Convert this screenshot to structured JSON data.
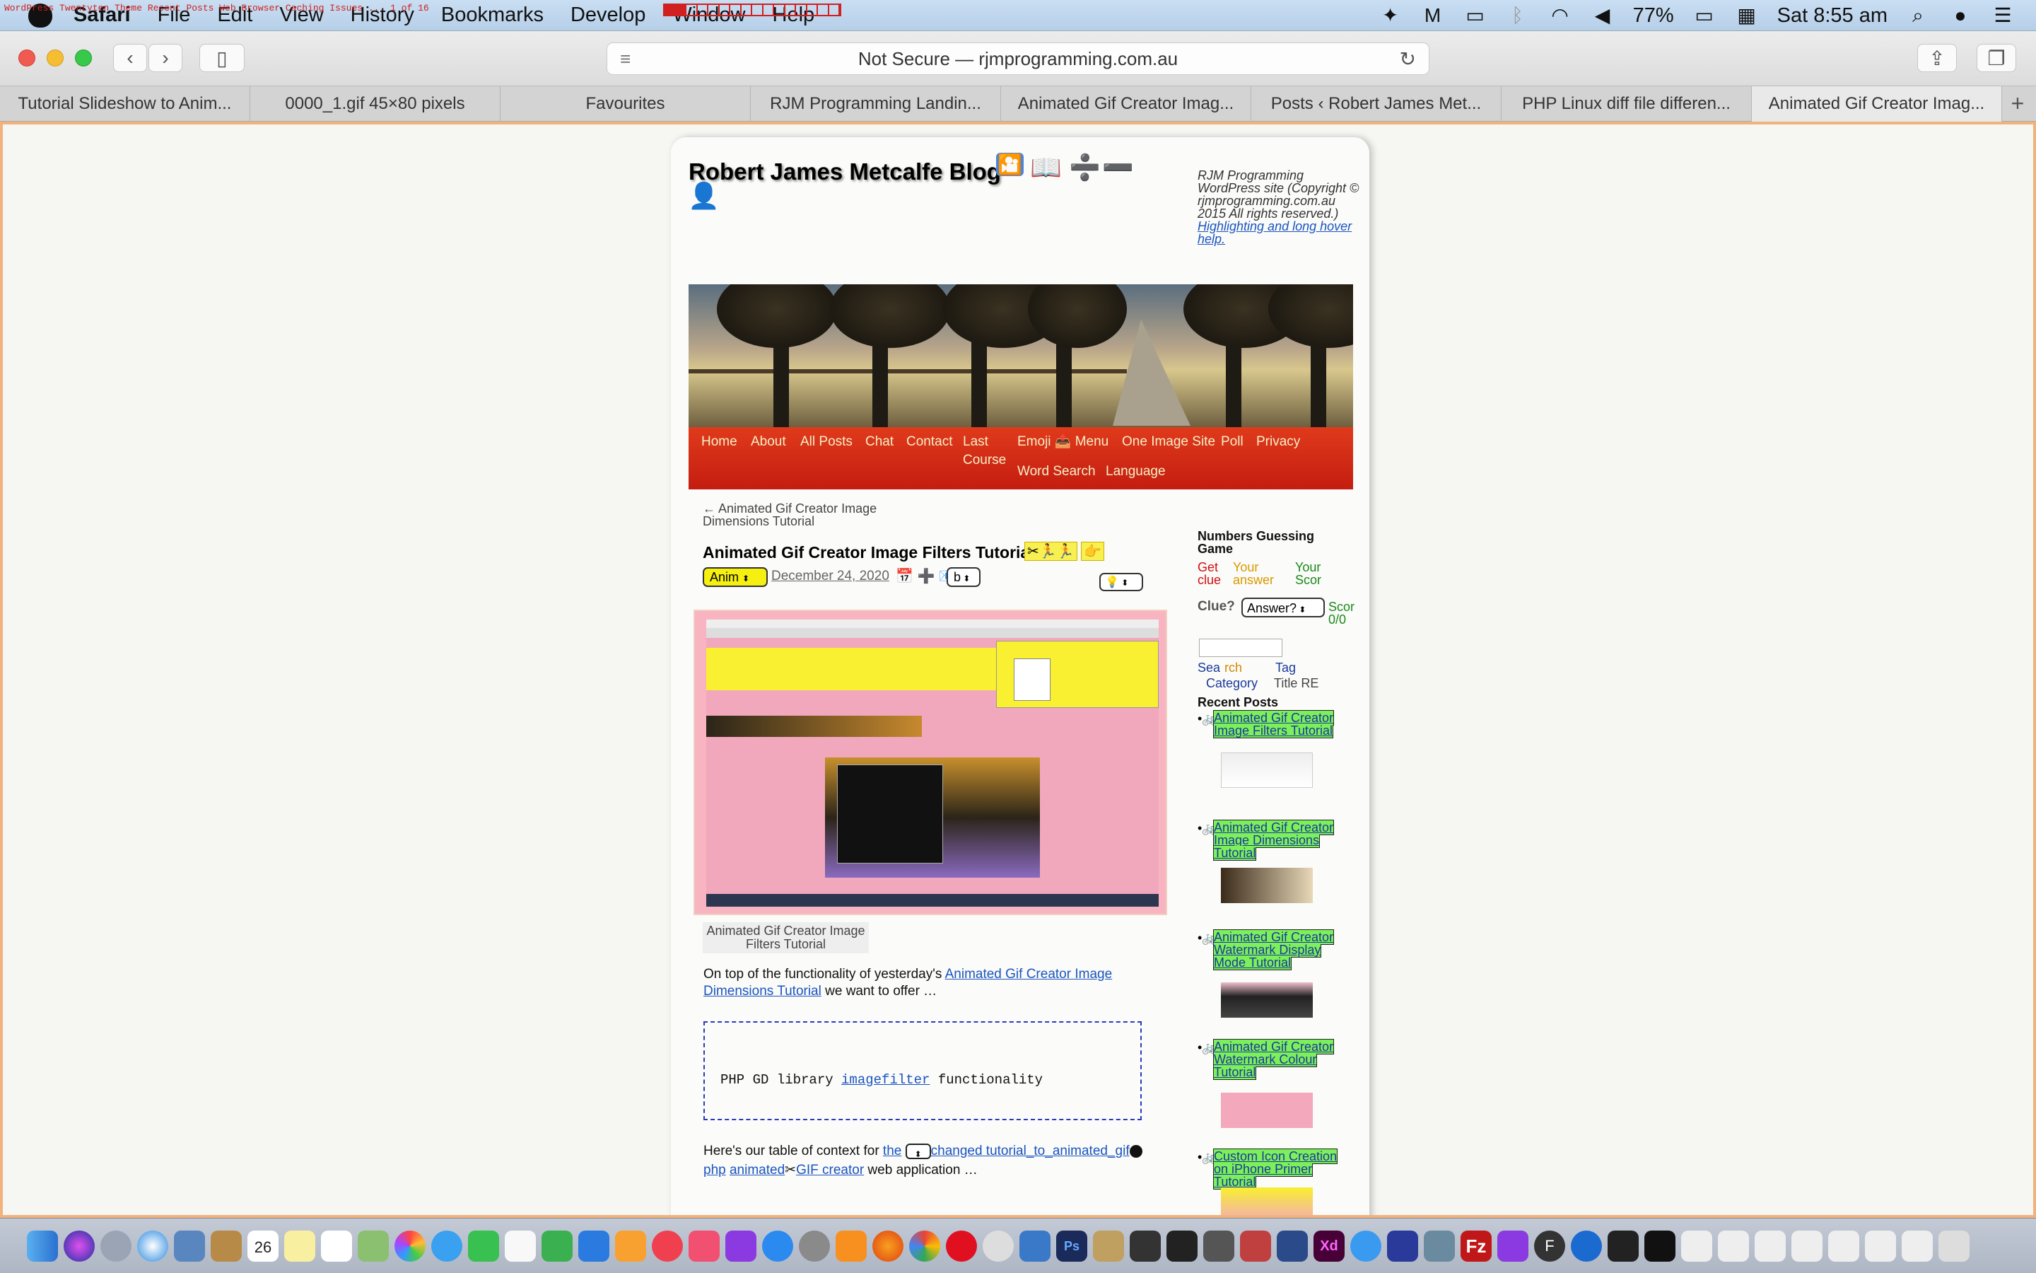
{
  "menubar": {
    "ticker": "WordPress Twentyten Theme Recent Posts Web Browser Caching Issues ... 1 of 16",
    "app": "Safari",
    "items": [
      "File",
      "Edit",
      "View",
      "History",
      "Bookmarks",
      "Develop",
      "Window",
      "Help"
    ],
    "battery": "77%",
    "clock": "Sat 8:55 am"
  },
  "toolbar": {
    "url": "Not Secure — rjmprogramming.com.au"
  },
  "tabs": [
    "Tutorial Slideshow to Anim...",
    "0000_1.gif 45×80 pixels",
    "Favourites",
    "RJM Programming Landin...",
    "Animated Gif Creator Imag...",
    "Posts ‹ Robert James Met...",
    "PHP Linux diff file differen...",
    "Animated Gif Creator Imag..."
  ],
  "blog": {
    "title": "Robert James Metcalfe Blog",
    "title_icons": [
      "🎦",
      "📖",
      "➗",
      "➖",
      "👤"
    ],
    "note_line1": "RJM Programming WordPress site (Copyright © rjmprogramming.com.au 2015 All rights reserved.)",
    "note_link": "Highlighting and long hover help."
  },
  "nav": [
    {
      "label": "Home"
    },
    {
      "label": "About"
    },
    {
      "label": "All Posts"
    },
    {
      "label": "Chat"
    },
    {
      "label": "Contact"
    },
    {
      "label": "Last Course"
    },
    {
      "label": "Emoji 📤 Menu"
    },
    {
      "label": "One Image Site"
    },
    {
      "label": "Poll"
    },
    {
      "label": "Privacy"
    },
    {
      "label": "Word Search"
    },
    {
      "label": "Language"
    }
  ],
  "post": {
    "prev_link": "← Animated Gif Creator Image Dimensions Tutorial",
    "title": "Animated Gif Creator Image Filters Tutorial",
    "title_emojis": "✂🏃🏃",
    "title_emoji2": "👉",
    "category_select": "Anim",
    "date": "December 24, 2020",
    "date_icons": "📅 ➕ 📧",
    "b_select": "b",
    "bulb_select": "💡",
    "caption": "Animated Gif Creator Image Filters Tutorial",
    "intro_prefix": "On top of the functionality of yesterday's ",
    "intro_link": "Animated Gif Creator Image Dimensions Tutorial",
    "intro_suffix": " we want to offer …",
    "code_prefix": "PHP GD library ",
    "code_link": "imagefilter",
    "code_suffix": " functionality",
    "context_prefix": "Here's our table of context for ",
    "context_link1": "the",
    "context_link2": "changed tutorial_to_animated_gif",
    "context_link2b": "php",
    "context_link3": "animated",
    "context_link3b": "GIF creator",
    "context_suffix": " web application …"
  },
  "sidebar": {
    "game_title": "Numbers Guessing Game",
    "get_clue": "Get clue",
    "your_answer": "Your answer",
    "your_score": "Your Scor",
    "clue_label": "Clue?",
    "answer_select": "Answer?",
    "score_label": "Scor",
    "score_value": "0/0",
    "search_sea": "Sea",
    "search_rch": "rch",
    "search_tag": "Tag",
    "search_category": "Category",
    "search_title": "Title RE",
    "recent_heading": "Recent Posts",
    "recent": [
      {
        "title": "Animated Gif Creator Image Filters Tutorial"
      },
      {
        "title": "Animated Gif Creator Image Dimensions Tutorial"
      },
      {
        "title": "Animated Gif Creator Watermark Display Mode Tutorial"
      },
      {
        "title": "Animated Gif Creator Watermark Colour Tutorial"
      },
      {
        "title": "Custom Icon Creation on iPhone Primer Tutorial"
      }
    ]
  },
  "dock_date": "26",
  "colors": {
    "nav_red": "#c41d10",
    "nav_text": "#f4f0c6",
    "link_blue": "#1a55c0",
    "recent_highlight": "#7cf05a",
    "content_border": "#f2b27c"
  }
}
